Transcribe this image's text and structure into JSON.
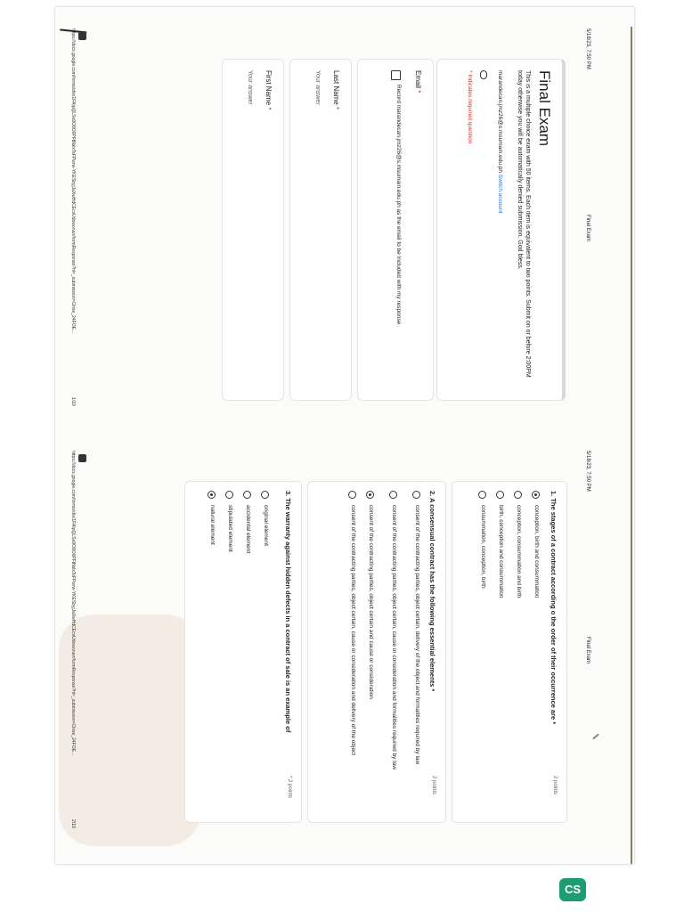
{
  "page1": {
    "timestamp": "5/18/23, 7:50 PM",
    "header_title": "Final Exam",
    "footer_url": "https://docs.google.com/forms/d/e/1FAIpQLSe9O8O0PFtNslxTsFPwrw-YKESbyjJaXwHdCEcvUdoworuvr/formResponse?hl=_submission=Clnse_24FOE...",
    "footer_page": "1/19",
    "form_title": "Final Exam",
    "description": "This is a multiple choice exam with 50 items. Each item is equivalent to two points. Submit on or before 2:00PM today otherwise you will be automatically denied submission. God bless.",
    "account_email": "marandecan.jmz26@s.msumain.edu.ph",
    "switch_account": "Switch account",
    "required_note": "* Indicates required question",
    "email_label": "Email",
    "record_text": "Record marandecan.jmz26@s.msumain.edu.ph as the email to be included with my response",
    "last_name_label": "Last Name",
    "first_name_label": "First Name",
    "answer_placeholder": "Your answer",
    "required_star": "*"
  },
  "page2": {
    "timestamp": "5/18/23, 7:50 PM",
    "header_title": "Final Exam",
    "footer_url": "https://docs.google.com/forms/d/e/1FAIpQLSe9O8O0PFtNslxTsFPwrw-YKESbyjJaXwHdCEcvUdoworuvr/formResponse?hl=_submission=Clnse_24FOE...",
    "footer_page": "2/19",
    "questions": [
      {
        "title": "1. The stages of a contract according o the order of their occurrence are *",
        "points": "2 points",
        "options": [
          "conception, birth and consummation",
          "conception, consummation and birth",
          "birth, conception and consummation",
          "consummation, conception, birth"
        ],
        "selected": 0
      },
      {
        "title": "2. A consensual contract has the following essential elements *",
        "points": "2 points",
        "options": [
          "consent of the contracting parties, object certain, delivery of the object and formalities required by law",
          "consent of the contracting parties, object certain, cause or consideration and formalities required by law",
          "consent of the contracting parties, object certain and cause or consideration",
          "consent of the contracting parties, object certain, cause or consideration and delivery of the object"
        ],
        "selected": 2
      },
      {
        "title": "3. The warranty against hidden defects in a contract of sale is an example of",
        "points": "* 2 points",
        "options": [
          "original element",
          "accidental element",
          "stipulated element",
          "natural element"
        ],
        "selected": 3
      }
    ]
  },
  "badge": {
    "label": "CS",
    "color": "#1f9d72"
  },
  "colors": {
    "required_red": "#d93025",
    "link_blue": "#1a73e8"
  }
}
